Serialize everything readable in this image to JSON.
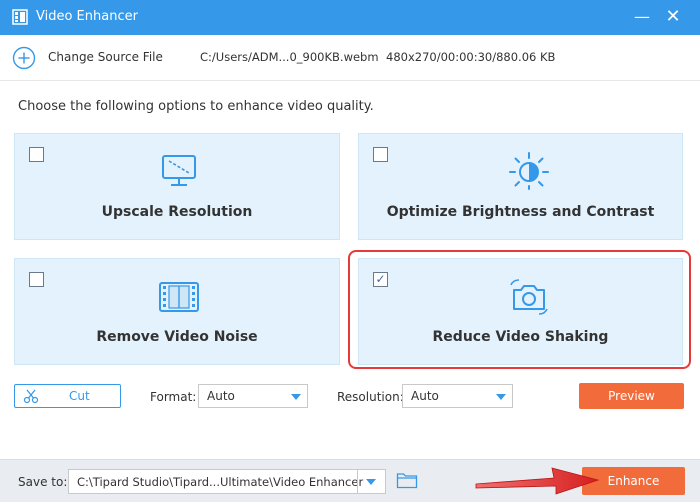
{
  "window": {
    "title": "Video Enhancer",
    "minimize_glyph": "—",
    "close_glyph": "✕"
  },
  "source": {
    "change_label": "Change Source File",
    "file_path": "C:/Users/ADM...0_900KB.webm",
    "file_info": "480x270/00:00:30/880.06 KB"
  },
  "instruction": "Choose the following options to enhance video quality.",
  "options": [
    {
      "label": "Upscale Resolution",
      "checked": false,
      "icon": "monitor-icon"
    },
    {
      "label": "Optimize Brightness and Contrast",
      "checked": false,
      "icon": "brightness-icon"
    },
    {
      "label": "Remove Video Noise",
      "checked": false,
      "icon": "film-icon"
    },
    {
      "label": "Reduce Video Shaking",
      "checked": true,
      "icon": "camera-shake-icon"
    }
  ],
  "check_glyph": "✓",
  "controls": {
    "cut_label": "Cut",
    "format_label": "Format:",
    "format_value": "Auto",
    "resolution_label": "Resolution:",
    "resolution_value": "Auto",
    "preview_label": "Preview"
  },
  "bottom": {
    "save_label": "Save to:",
    "save_path": "C:\\Tipard Studio\\Tipard...Ultimate\\Video Enhancer",
    "enhance_label": "Enhance"
  },
  "colors": {
    "title_bar": "#3598e8",
    "accent_orange": "#f26b3a",
    "card_bg": "#e3f2fc",
    "highlight_red": "#e53a3a"
  }
}
